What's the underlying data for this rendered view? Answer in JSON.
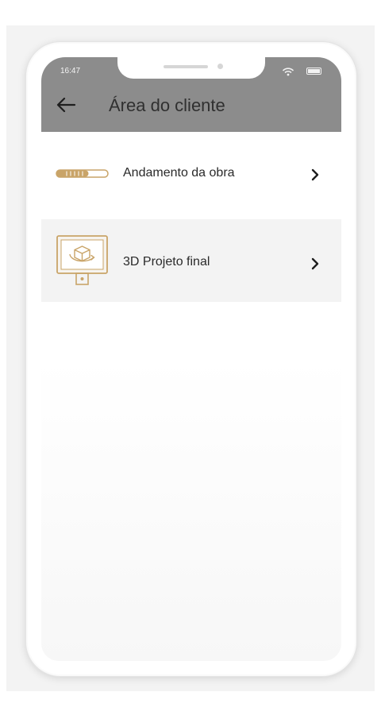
{
  "status_bar": {
    "time": "16:47"
  },
  "header": {
    "title": "Área do cliente"
  },
  "menu": {
    "items": [
      {
        "label": "Andamento da obra",
        "icon": "progress-bar-icon"
      },
      {
        "label": "3D Projeto final",
        "icon": "monitor-3d-icon"
      }
    ]
  },
  "colors": {
    "header_bg": "#8c8c8c",
    "accent": "#c9a468",
    "text": "#2a2a2a"
  }
}
